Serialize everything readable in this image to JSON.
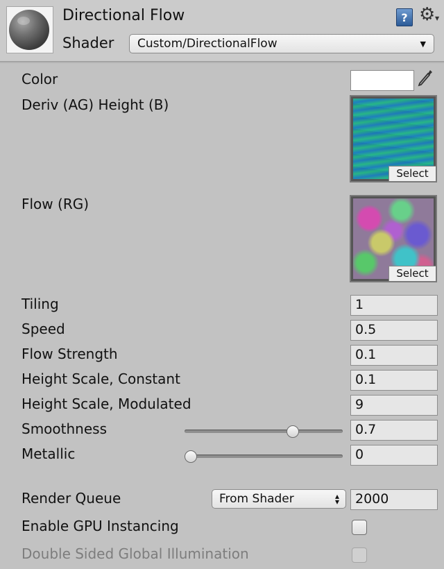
{
  "header": {
    "title": "Directional Flow",
    "shader_label": "Shader",
    "shader_value": "Custom/DirectionalFlow",
    "help_icon": "help-book-icon",
    "settings_icon": "gear-icon"
  },
  "properties": {
    "color": {
      "label": "Color",
      "value": "#ffffff"
    },
    "deriv": {
      "label": "Deriv (AG) Height (B)",
      "select_label": "Select"
    },
    "flow": {
      "label": "Flow (RG)",
      "select_label": "Select"
    },
    "tiling": {
      "label": "Tiling",
      "value": "1"
    },
    "speed": {
      "label": "Speed",
      "value": "0.5"
    },
    "flow_strength": {
      "label": "Flow Strength",
      "value": "0.1"
    },
    "height_scale_constant": {
      "label": "Height Scale, Constant",
      "value": "0.1"
    },
    "height_scale_modulated": {
      "label": "Height Scale, Modulated",
      "value": "9"
    },
    "smoothness": {
      "label": "Smoothness",
      "value": "0.7",
      "slider_fraction": 0.7
    },
    "metallic": {
      "label": "Metallic",
      "value": "0",
      "slider_fraction": 0.0
    }
  },
  "render": {
    "queue_label": "Render Queue",
    "queue_mode": "From Shader",
    "queue_value": "2000",
    "gpu_instancing_label": "Enable GPU Instancing",
    "gpu_instancing_checked": false,
    "double_sided_gi_label": "Double Sided Global Illumination",
    "double_sided_gi_checked": false
  }
}
